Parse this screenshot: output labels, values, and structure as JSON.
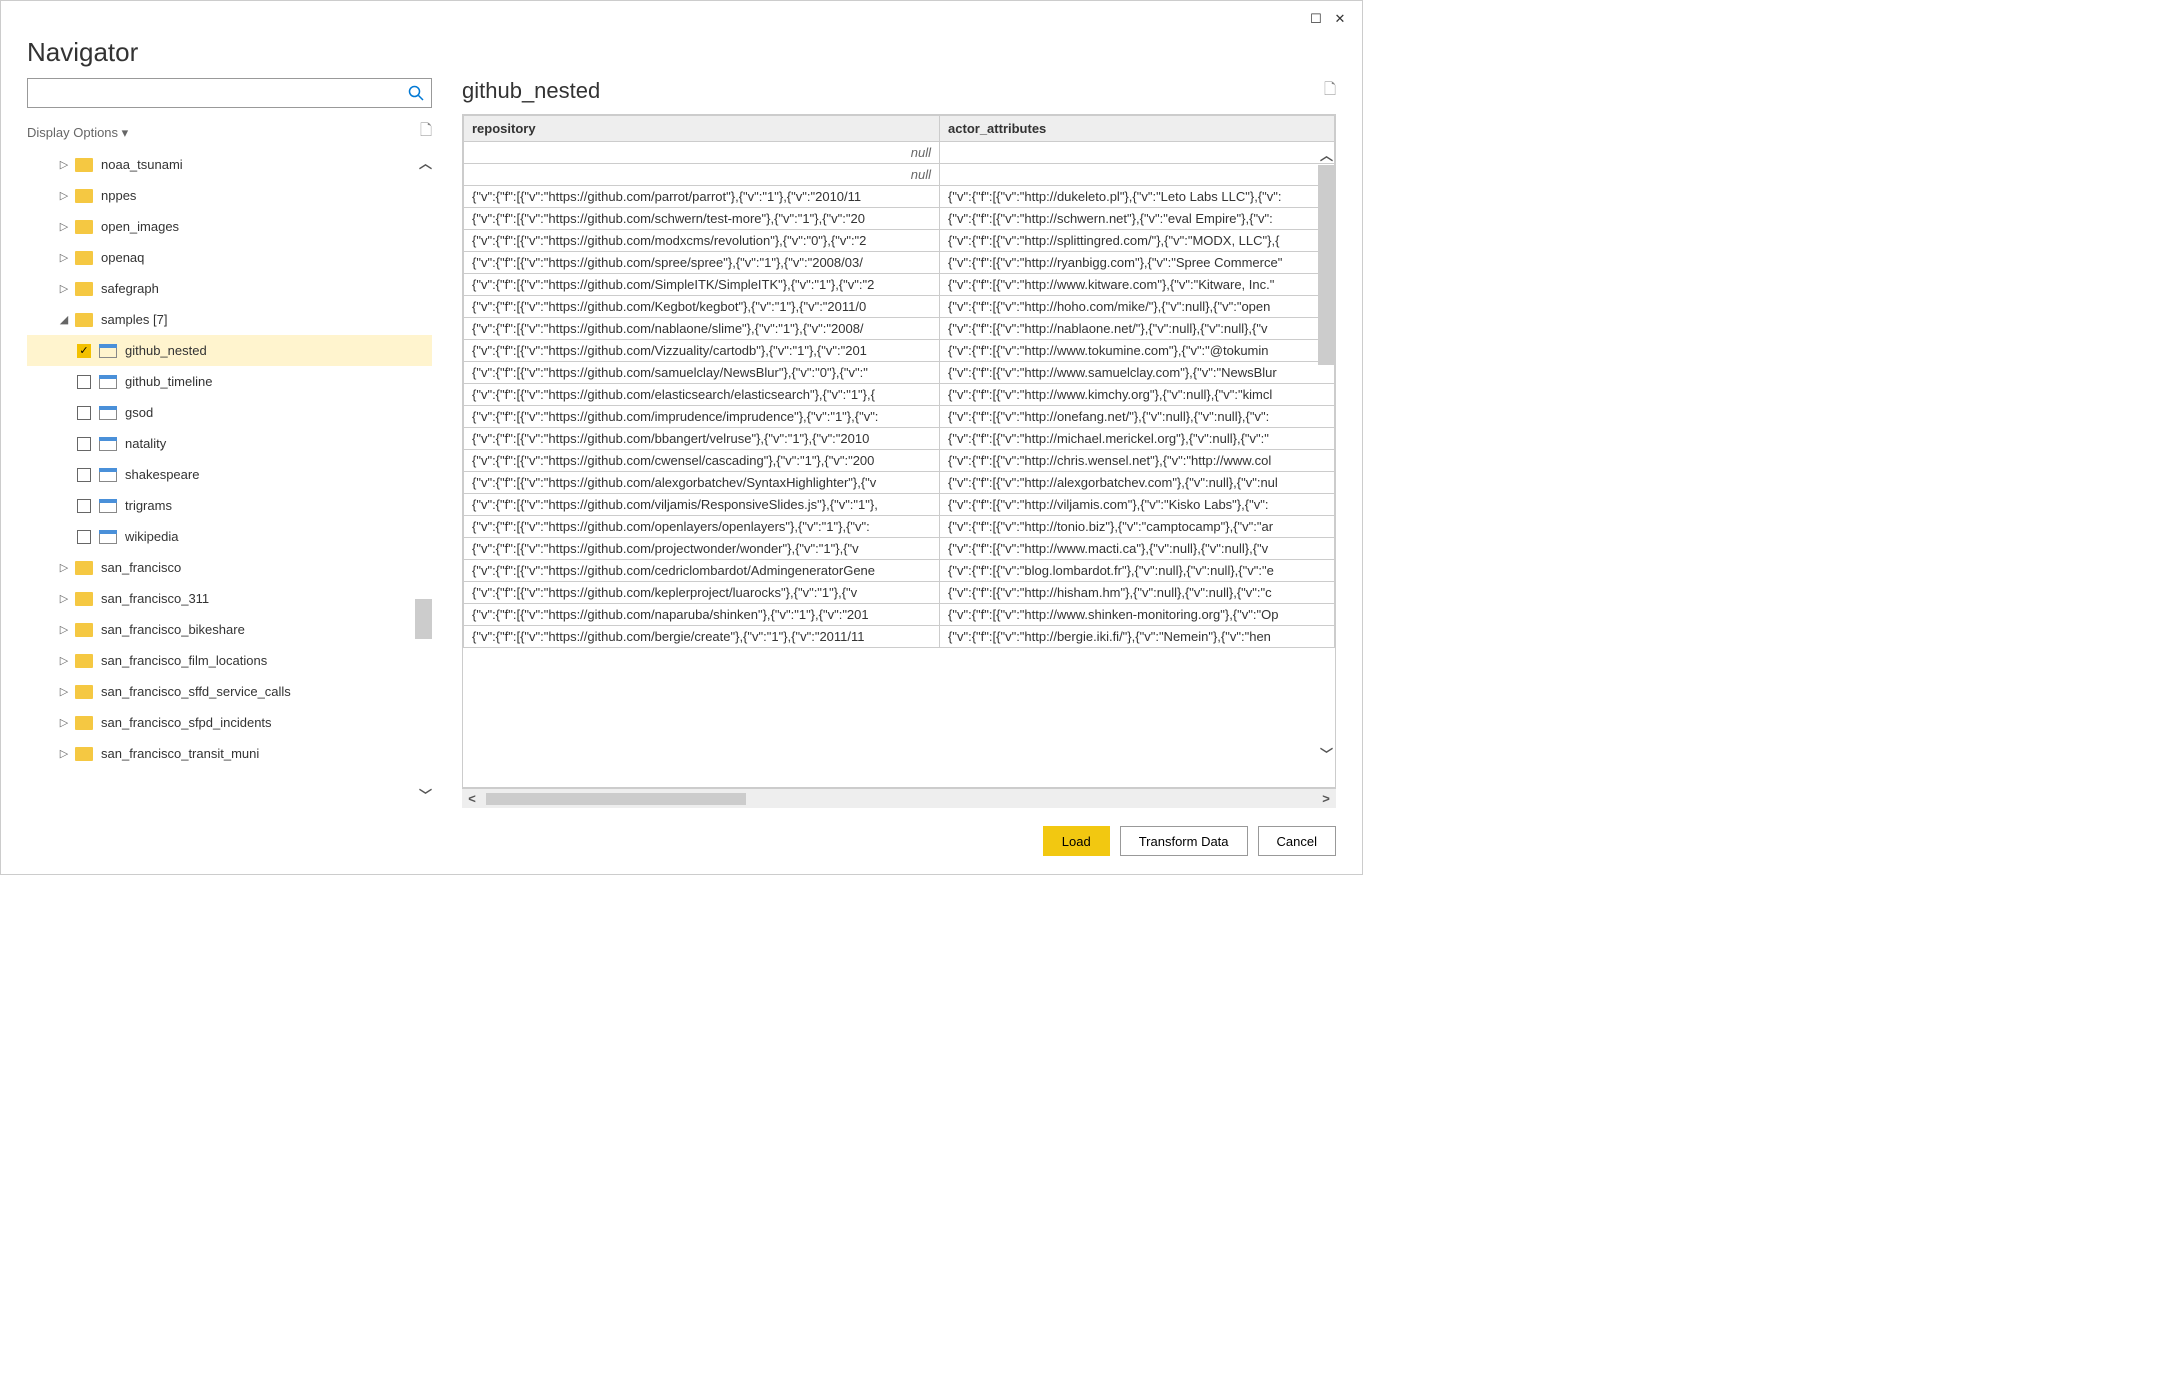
{
  "title": "Navigator",
  "display_options": "Display Options",
  "preview_title": "github_nested",
  "search_placeholder": "",
  "tree": [
    {
      "checkbox": false,
      "caret": "▷",
      "icon": "folder",
      "label": "noaa_tsunami"
    },
    {
      "checkbox": false,
      "caret": "▷",
      "icon": "folder",
      "label": "nppes"
    },
    {
      "checkbox": false,
      "caret": "▷",
      "icon": "folder",
      "label": "open_images"
    },
    {
      "checkbox": false,
      "caret": "▷",
      "icon": "folder",
      "label": "openaq"
    },
    {
      "checkbox": false,
      "caret": "▷",
      "icon": "folder",
      "label": "safegraph"
    },
    {
      "checkbox": false,
      "caret": "◢",
      "icon": "folder",
      "label": "samples [7]",
      "expanded": true
    },
    {
      "checkbox": true,
      "checked": true,
      "icon": "table",
      "label": "github_nested",
      "selected": true
    },
    {
      "checkbox": true,
      "checked": false,
      "icon": "table",
      "label": "github_timeline"
    },
    {
      "checkbox": true,
      "checked": false,
      "icon": "table",
      "label": "gsod"
    },
    {
      "checkbox": true,
      "checked": false,
      "icon": "table",
      "label": "natality"
    },
    {
      "checkbox": true,
      "checked": false,
      "icon": "table",
      "label": "shakespeare"
    },
    {
      "checkbox": true,
      "checked": false,
      "icon": "table",
      "label": "trigrams"
    },
    {
      "checkbox": true,
      "checked": false,
      "icon": "table",
      "label": "wikipedia"
    },
    {
      "checkbox": false,
      "caret": "▷",
      "icon": "folder",
      "label": "san_francisco"
    },
    {
      "checkbox": false,
      "caret": "▷",
      "icon": "folder",
      "label": "san_francisco_311"
    },
    {
      "checkbox": false,
      "caret": "▷",
      "icon": "folder",
      "label": "san_francisco_bikeshare"
    },
    {
      "checkbox": false,
      "caret": "▷",
      "icon": "folder",
      "label": "san_francisco_film_locations"
    },
    {
      "checkbox": false,
      "caret": "▷",
      "icon": "folder",
      "label": "san_francisco_sffd_service_calls"
    },
    {
      "checkbox": false,
      "caret": "▷",
      "icon": "folder",
      "label": "san_francisco_sfpd_incidents"
    },
    {
      "checkbox": false,
      "caret": "▷",
      "icon": "folder",
      "label": "san_francisco_transit_muni"
    }
  ],
  "columns": [
    "repository",
    "actor_attributes"
  ],
  "rows": [
    {
      "repository": "null",
      "actor_attributes": ""
    },
    {
      "repository": "null",
      "actor_attributes": ""
    },
    {
      "repository": "{\"v\":{\"f\":[{\"v\":\"https://github.com/parrot/parrot\"},{\"v\":\"1\"},{\"v\":\"2010/11",
      "actor_attributes": "{\"v\":{\"f\":[{\"v\":\"http://dukeleto.pl\"},{\"v\":\"Leto Labs LLC\"},{\"v\":"
    },
    {
      "repository": "{\"v\":{\"f\":[{\"v\":\"https://github.com/schwern/test-more\"},{\"v\":\"1\"},{\"v\":\"20",
      "actor_attributes": "{\"v\":{\"f\":[{\"v\":\"http://schwern.net\"},{\"v\":\"eval Empire\"},{\"v\":"
    },
    {
      "repository": "{\"v\":{\"f\":[{\"v\":\"https://github.com/modxcms/revolution\"},{\"v\":\"0\"},{\"v\":\"2",
      "actor_attributes": "{\"v\":{\"f\":[{\"v\":\"http://splittingred.com/\"},{\"v\":\"MODX, LLC\"},{"
    },
    {
      "repository": "{\"v\":{\"f\":[{\"v\":\"https://github.com/spree/spree\"},{\"v\":\"1\"},{\"v\":\"2008/03/",
      "actor_attributes": "{\"v\":{\"f\":[{\"v\":\"http://ryanbigg.com\"},{\"v\":\"Spree Commerce\""
    },
    {
      "repository": "{\"v\":{\"f\":[{\"v\":\"https://github.com/SimpleITK/SimpleITK\"},{\"v\":\"1\"},{\"v\":\"2",
      "actor_attributes": "{\"v\":{\"f\":[{\"v\":\"http://www.kitware.com\"},{\"v\":\"Kitware, Inc.\""
    },
    {
      "repository": "{\"v\":{\"f\":[{\"v\":\"https://github.com/Kegbot/kegbot\"},{\"v\":\"1\"},{\"v\":\"2011/0",
      "actor_attributes": "{\"v\":{\"f\":[{\"v\":\"http://hoho.com/mike/\"},{\"v\":null},{\"v\":\"open"
    },
    {
      "repository": "{\"v\":{\"f\":[{\"v\":\"https://github.com/nablaone/slime\"},{\"v\":\"1\"},{\"v\":\"2008/",
      "actor_attributes": "{\"v\":{\"f\":[{\"v\":\"http://nablaone.net/\"},{\"v\":null},{\"v\":null},{\"v"
    },
    {
      "repository": "{\"v\":{\"f\":[{\"v\":\"https://github.com/Vizzuality/cartodb\"},{\"v\":\"1\"},{\"v\":\"201",
      "actor_attributes": "{\"v\":{\"f\":[{\"v\":\"http://www.tokumine.com\"},{\"v\":\"@tokumin"
    },
    {
      "repository": "{\"v\":{\"f\":[{\"v\":\"https://github.com/samuelclay/NewsBlur\"},{\"v\":\"0\"},{\"v\":\"",
      "actor_attributes": "{\"v\":{\"f\":[{\"v\":\"http://www.samuelclay.com\"},{\"v\":\"NewsBlur"
    },
    {
      "repository": "{\"v\":{\"f\":[{\"v\":\"https://github.com/elasticsearch/elasticsearch\"},{\"v\":\"1\"},{",
      "actor_attributes": "{\"v\":{\"f\":[{\"v\":\"http://www.kimchy.org\"},{\"v\":null},{\"v\":\"kimcl"
    },
    {
      "repository": "{\"v\":{\"f\":[{\"v\":\"https://github.com/imprudence/imprudence\"},{\"v\":\"1\"},{\"v\":",
      "actor_attributes": "{\"v\":{\"f\":[{\"v\":\"http://onefang.net/\"},{\"v\":null},{\"v\":null},{\"v\":"
    },
    {
      "repository": "{\"v\":{\"f\":[{\"v\":\"https://github.com/bbangert/velruse\"},{\"v\":\"1\"},{\"v\":\"2010",
      "actor_attributes": "{\"v\":{\"f\":[{\"v\":\"http://michael.merickel.org\"},{\"v\":null},{\"v\":\""
    },
    {
      "repository": "{\"v\":{\"f\":[{\"v\":\"https://github.com/cwensel/cascading\"},{\"v\":\"1\"},{\"v\":\"200",
      "actor_attributes": "{\"v\":{\"f\":[{\"v\":\"http://chris.wensel.net\"},{\"v\":\"http://www.col"
    },
    {
      "repository": "{\"v\":{\"f\":[{\"v\":\"https://github.com/alexgorbatchev/SyntaxHighlighter\"},{\"v",
      "actor_attributes": "{\"v\":{\"f\":[{\"v\":\"http://alexgorbatchev.com\"},{\"v\":null},{\"v\":nul"
    },
    {
      "repository": "{\"v\":{\"f\":[{\"v\":\"https://github.com/viljamis/ResponsiveSlides.js\"},{\"v\":\"1\"},",
      "actor_attributes": "{\"v\":{\"f\":[{\"v\":\"http://viljamis.com\"},{\"v\":\"Kisko Labs\"},{\"v\":"
    },
    {
      "repository": "{\"v\":{\"f\":[{\"v\":\"https://github.com/openlayers/openlayers\"},{\"v\":\"1\"},{\"v\":",
      "actor_attributes": "{\"v\":{\"f\":[{\"v\":\"http://tonio.biz\"},{\"v\":\"camptocamp\"},{\"v\":\"ar"
    },
    {
      "repository": "{\"v\":{\"f\":[{\"v\":\"https://github.com/projectwonder/wonder\"},{\"v\":\"1\"},{\"v",
      "actor_attributes": "{\"v\":{\"f\":[{\"v\":\"http://www.macti.ca\"},{\"v\":null},{\"v\":null},{\"v"
    },
    {
      "repository": "{\"v\":{\"f\":[{\"v\":\"https://github.com/cedriclombardot/AdmingeneratorGene",
      "actor_attributes": "{\"v\":{\"f\":[{\"v\":\"blog.lombardot.fr\"},{\"v\":null},{\"v\":null},{\"v\":\"e"
    },
    {
      "repository": "{\"v\":{\"f\":[{\"v\":\"https://github.com/keplerproject/luarocks\"},{\"v\":\"1\"},{\"v",
      "actor_attributes": "{\"v\":{\"f\":[{\"v\":\"http://hisham.hm\"},{\"v\":null},{\"v\":null},{\"v\":\"c"
    },
    {
      "repository": "{\"v\":{\"f\":[{\"v\":\"https://github.com/naparuba/shinken\"},{\"v\":\"1\"},{\"v\":\"201",
      "actor_attributes": "{\"v\":{\"f\":[{\"v\":\"http://www.shinken-monitoring.org\"},{\"v\":\"Op"
    },
    {
      "repository": "{\"v\":{\"f\":[{\"v\":\"https://github.com/bergie/create\"},{\"v\":\"1\"},{\"v\":\"2011/11",
      "actor_attributes": "{\"v\":{\"f\":[{\"v\":\"http://bergie.iki.fi/\"},{\"v\":\"Nemein\"},{\"v\":\"hen"
    }
  ],
  "buttons": {
    "load": "Load",
    "transform": "Transform Data",
    "cancel": "Cancel"
  }
}
